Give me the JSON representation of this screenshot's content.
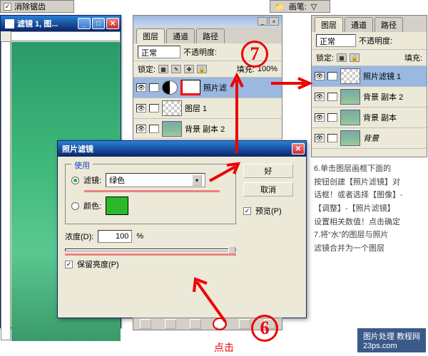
{
  "topbar": {
    "antialias": "消除锯齿"
  },
  "topbar_r": {
    "brush": "画笔:",
    "flow": "▽"
  },
  "docwin": {
    "title": "滤镜 1, 图..."
  },
  "panel_left": {
    "tabs": [
      "图层",
      "通道",
      "路径"
    ],
    "blend": "正常",
    "opacity_label": "不透明度:",
    "opacity": "",
    "lock_label": "锁定:",
    "fill_label": "填充:",
    "fill": "100%",
    "layers": [
      {
        "name": "照片滤"
      },
      {
        "name": "图层 1"
      },
      {
        "name": "背景 副本 2"
      }
    ]
  },
  "panel_right": {
    "tabs": [
      "图层",
      "通道",
      "路径"
    ],
    "blend": "正常",
    "opacity_label": "不透明度:",
    "lock_label": "锁定:",
    "fill_label": "填充:",
    "layers": [
      {
        "name": "照片滤镜 1"
      },
      {
        "name": "背景 副本 2"
      },
      {
        "name": "背景 副本"
      },
      {
        "name": "背景",
        "italic": true
      }
    ]
  },
  "dialog": {
    "title": "照片滤镜",
    "use_group": "使用",
    "filter_label": "滤镜:",
    "filter_value": "绿色",
    "color_label": "颜色:",
    "density_label": "浓度(D):",
    "density_value": "100",
    "density_unit": "%",
    "preserve": "保留亮度(P)",
    "ok": "好",
    "cancel": "取消",
    "preview": "预览(P)"
  },
  "annotations": {
    "n6": "6",
    "n7": "7",
    "click": "点击"
  },
  "instructions": "6.单击图层画框下面的\n按钮创建【照片滤镜】对\n话框！或者选择【图像】-\n【调整】-【照片滤镜】\n设置相关数值！点击确定\n7.将“水”的图层与照片\n滤镜合并为一个图层",
  "watermark": "图片处理 教程网\n23ps.com"
}
